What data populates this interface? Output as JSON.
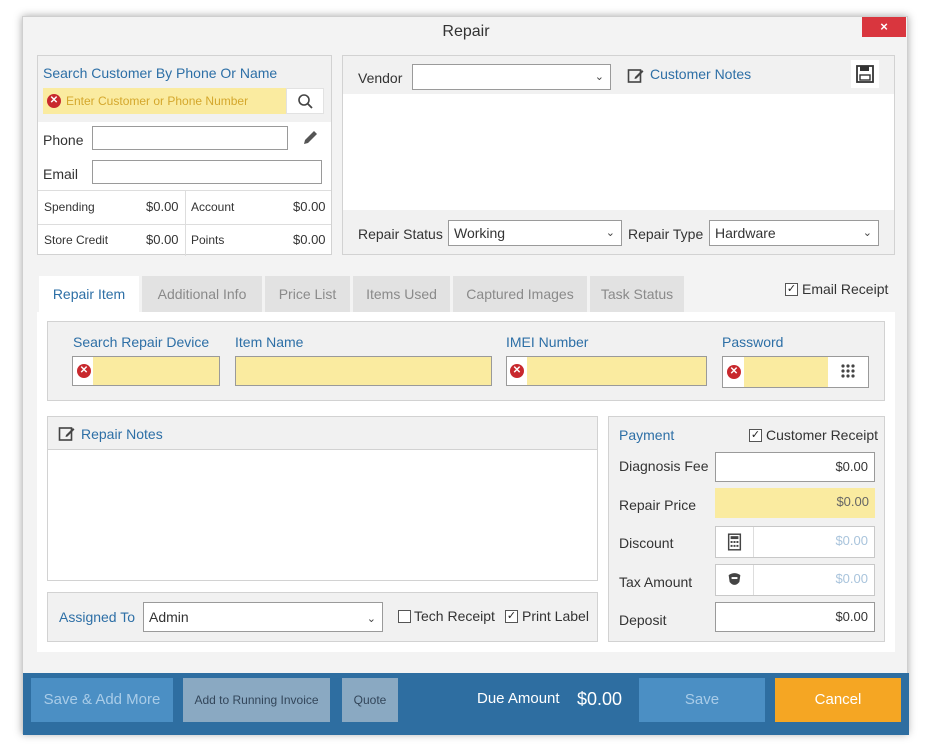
{
  "window": {
    "title": "Repair",
    "close_label": "×"
  },
  "customer": {
    "search_title": "Search Customer By Phone Or Name",
    "search_placeholder": "Enter Customer or Phone Number",
    "phone_label": "Phone",
    "email_label": "Email",
    "stats": [
      {
        "label": "Spending",
        "value": "$0.00"
      },
      {
        "label": "Account",
        "value": "$0.00"
      },
      {
        "label": "Store Credit",
        "value": "$0.00"
      },
      {
        "label": "Points",
        "value": "$0.00"
      }
    ]
  },
  "vendor": {
    "label": "Vendor",
    "value": ""
  },
  "customer_notes": {
    "label": "Customer Notes"
  },
  "repair_status": {
    "label": "Repair Status",
    "value": "Working"
  },
  "repair_type": {
    "label": "Repair Type",
    "value": "Hardware"
  },
  "tabs": [
    {
      "label": "Repair Item"
    },
    {
      "label": "Additional Info"
    },
    {
      "label": "Price List"
    },
    {
      "label": "Items Used"
    },
    {
      "label": "Captured Images"
    },
    {
      "label": "Task Status"
    }
  ],
  "email_receipt": {
    "label": "Email Receipt",
    "checked": true
  },
  "item_fields": {
    "device_label": "Search Repair Device",
    "item_name_label": "Item Name",
    "imei_label": "IMEI Number",
    "password_label": "Password"
  },
  "repair_notes": {
    "label": "Repair Notes"
  },
  "assigned": {
    "label": "Assigned To",
    "value": "Admin"
  },
  "tech_receipt": {
    "label": "Tech Receipt",
    "checked": false
  },
  "print_label": {
    "label": "Print Label",
    "checked": true
  },
  "payment": {
    "title": "Payment",
    "customer_receipt": "Customer Receipt",
    "rows": [
      {
        "label": "Diagnosis Fee",
        "value": "$0.00"
      },
      {
        "label": "Repair Price",
        "value": "$0.00"
      },
      {
        "label": "Discount",
        "value": "$0.00"
      },
      {
        "label": "Tax Amount",
        "value": "$0.00"
      },
      {
        "label": "Deposit",
        "value": "$0.00"
      }
    ]
  },
  "footer": {
    "save_add_more": "Save & Add More",
    "add_running_invoice": "Add to Running Invoice",
    "quote": "Quote",
    "due_label": "Due Amount",
    "due_value": "$0.00",
    "save": "Save",
    "cancel": "Cancel"
  },
  "colors": {
    "accent": "#2d6fa6",
    "footer": "#2e6ea1",
    "cancel": "#f5a623",
    "yellow": "#faeba0",
    "close": "#d9363e"
  },
  "checkmark": "✓"
}
